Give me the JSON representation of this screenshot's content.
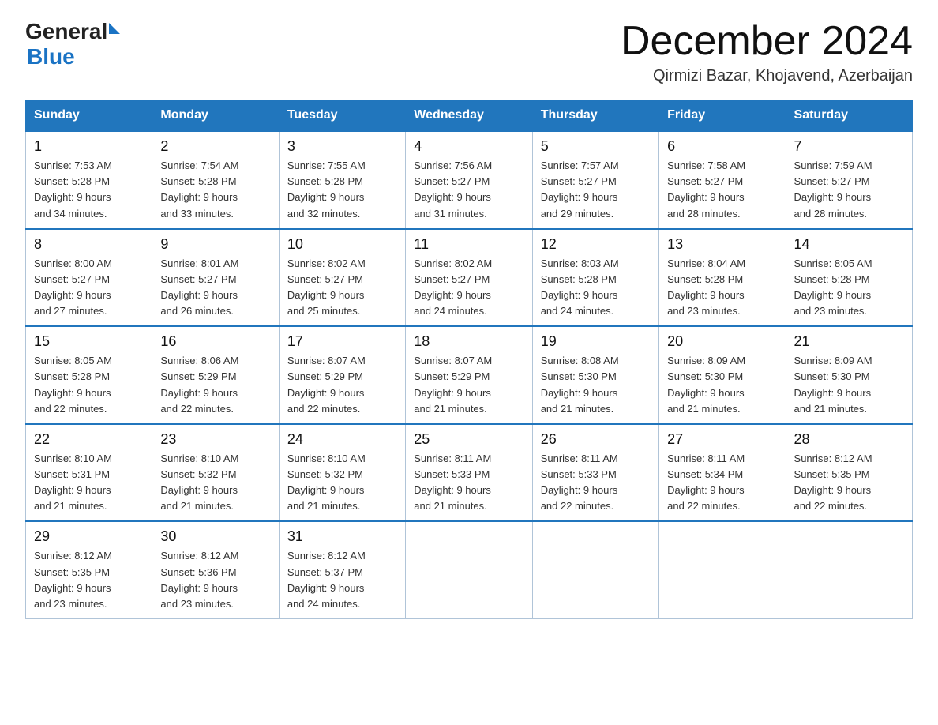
{
  "header": {
    "logo_general": "General",
    "logo_blue": "Blue",
    "month_title": "December 2024",
    "location": "Qirmizi Bazar, Khojavend, Azerbaijan"
  },
  "weekdays": [
    "Sunday",
    "Monday",
    "Tuesday",
    "Wednesday",
    "Thursday",
    "Friday",
    "Saturday"
  ],
  "weeks": [
    [
      {
        "day": "1",
        "sunrise": "7:53 AM",
        "sunset": "5:28 PM",
        "daylight": "9 hours and 34 minutes."
      },
      {
        "day": "2",
        "sunrise": "7:54 AM",
        "sunset": "5:28 PM",
        "daylight": "9 hours and 33 minutes."
      },
      {
        "day": "3",
        "sunrise": "7:55 AM",
        "sunset": "5:28 PM",
        "daylight": "9 hours and 32 minutes."
      },
      {
        "day": "4",
        "sunrise": "7:56 AM",
        "sunset": "5:27 PM",
        "daylight": "9 hours and 31 minutes."
      },
      {
        "day": "5",
        "sunrise": "7:57 AM",
        "sunset": "5:27 PM",
        "daylight": "9 hours and 29 minutes."
      },
      {
        "day": "6",
        "sunrise": "7:58 AM",
        "sunset": "5:27 PM",
        "daylight": "9 hours and 28 minutes."
      },
      {
        "day": "7",
        "sunrise": "7:59 AM",
        "sunset": "5:27 PM",
        "daylight": "9 hours and 28 minutes."
      }
    ],
    [
      {
        "day": "8",
        "sunrise": "8:00 AM",
        "sunset": "5:27 PM",
        "daylight": "9 hours and 27 minutes."
      },
      {
        "day": "9",
        "sunrise": "8:01 AM",
        "sunset": "5:27 PM",
        "daylight": "9 hours and 26 minutes."
      },
      {
        "day": "10",
        "sunrise": "8:02 AM",
        "sunset": "5:27 PM",
        "daylight": "9 hours and 25 minutes."
      },
      {
        "day": "11",
        "sunrise": "8:02 AM",
        "sunset": "5:27 PM",
        "daylight": "9 hours and 24 minutes."
      },
      {
        "day": "12",
        "sunrise": "8:03 AM",
        "sunset": "5:28 PM",
        "daylight": "9 hours and 24 minutes."
      },
      {
        "day": "13",
        "sunrise": "8:04 AM",
        "sunset": "5:28 PM",
        "daylight": "9 hours and 23 minutes."
      },
      {
        "day": "14",
        "sunrise": "8:05 AM",
        "sunset": "5:28 PM",
        "daylight": "9 hours and 23 minutes."
      }
    ],
    [
      {
        "day": "15",
        "sunrise": "8:05 AM",
        "sunset": "5:28 PM",
        "daylight": "9 hours and 22 minutes."
      },
      {
        "day": "16",
        "sunrise": "8:06 AM",
        "sunset": "5:29 PM",
        "daylight": "9 hours and 22 minutes."
      },
      {
        "day": "17",
        "sunrise": "8:07 AM",
        "sunset": "5:29 PM",
        "daylight": "9 hours and 22 minutes."
      },
      {
        "day": "18",
        "sunrise": "8:07 AM",
        "sunset": "5:29 PM",
        "daylight": "9 hours and 21 minutes."
      },
      {
        "day": "19",
        "sunrise": "8:08 AM",
        "sunset": "5:30 PM",
        "daylight": "9 hours and 21 minutes."
      },
      {
        "day": "20",
        "sunrise": "8:09 AM",
        "sunset": "5:30 PM",
        "daylight": "9 hours and 21 minutes."
      },
      {
        "day": "21",
        "sunrise": "8:09 AM",
        "sunset": "5:30 PM",
        "daylight": "9 hours and 21 minutes."
      }
    ],
    [
      {
        "day": "22",
        "sunrise": "8:10 AM",
        "sunset": "5:31 PM",
        "daylight": "9 hours and 21 minutes."
      },
      {
        "day": "23",
        "sunrise": "8:10 AM",
        "sunset": "5:32 PM",
        "daylight": "9 hours and 21 minutes."
      },
      {
        "day": "24",
        "sunrise": "8:10 AM",
        "sunset": "5:32 PM",
        "daylight": "9 hours and 21 minutes."
      },
      {
        "day": "25",
        "sunrise": "8:11 AM",
        "sunset": "5:33 PM",
        "daylight": "9 hours and 21 minutes."
      },
      {
        "day": "26",
        "sunrise": "8:11 AM",
        "sunset": "5:33 PM",
        "daylight": "9 hours and 22 minutes."
      },
      {
        "day": "27",
        "sunrise": "8:11 AM",
        "sunset": "5:34 PM",
        "daylight": "9 hours and 22 minutes."
      },
      {
        "day": "28",
        "sunrise": "8:12 AM",
        "sunset": "5:35 PM",
        "daylight": "9 hours and 22 minutes."
      }
    ],
    [
      {
        "day": "29",
        "sunrise": "8:12 AM",
        "sunset": "5:35 PM",
        "daylight": "9 hours and 23 minutes."
      },
      {
        "day": "30",
        "sunrise": "8:12 AM",
        "sunset": "5:36 PM",
        "daylight": "9 hours and 23 minutes."
      },
      {
        "day": "31",
        "sunrise": "8:12 AM",
        "sunset": "5:37 PM",
        "daylight": "9 hours and 24 minutes."
      },
      null,
      null,
      null,
      null
    ]
  ]
}
